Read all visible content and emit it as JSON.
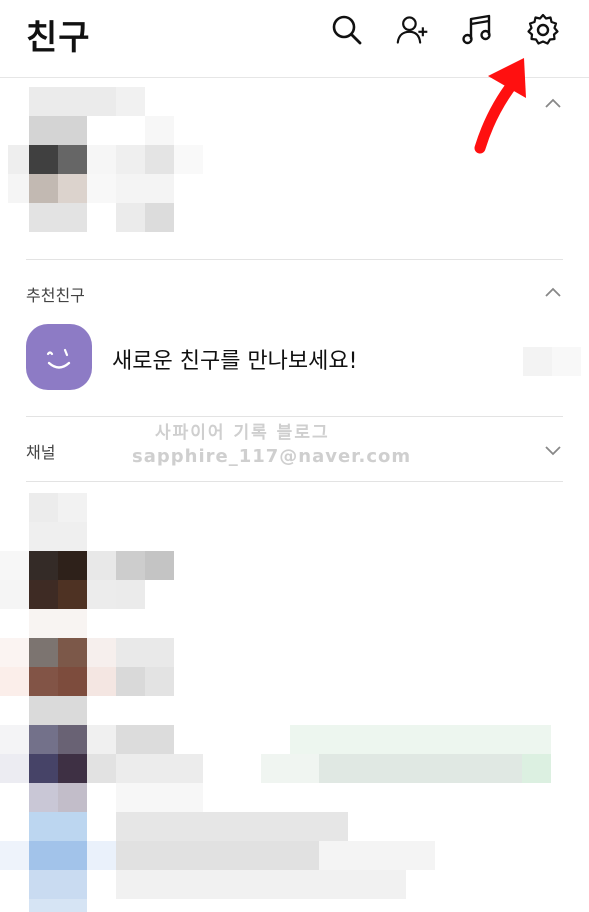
{
  "header": {
    "title": "친구",
    "icons": [
      "search-icon",
      "add-friend-icon",
      "music-icon",
      "settings-icon"
    ]
  },
  "sections": {
    "recommended": {
      "label": "추천친구"
    },
    "channel": {
      "label": "채널"
    }
  },
  "recommendation": {
    "text": "새로운 친구를 만나보세요!"
  },
  "watermark": {
    "line1": "사파이어 기록 블로그",
    "line2": "sapphire_117@naver.com"
  },
  "colors": {
    "annotation_arrow": "#ff0000",
    "avatar": "#8d7bc5"
  }
}
